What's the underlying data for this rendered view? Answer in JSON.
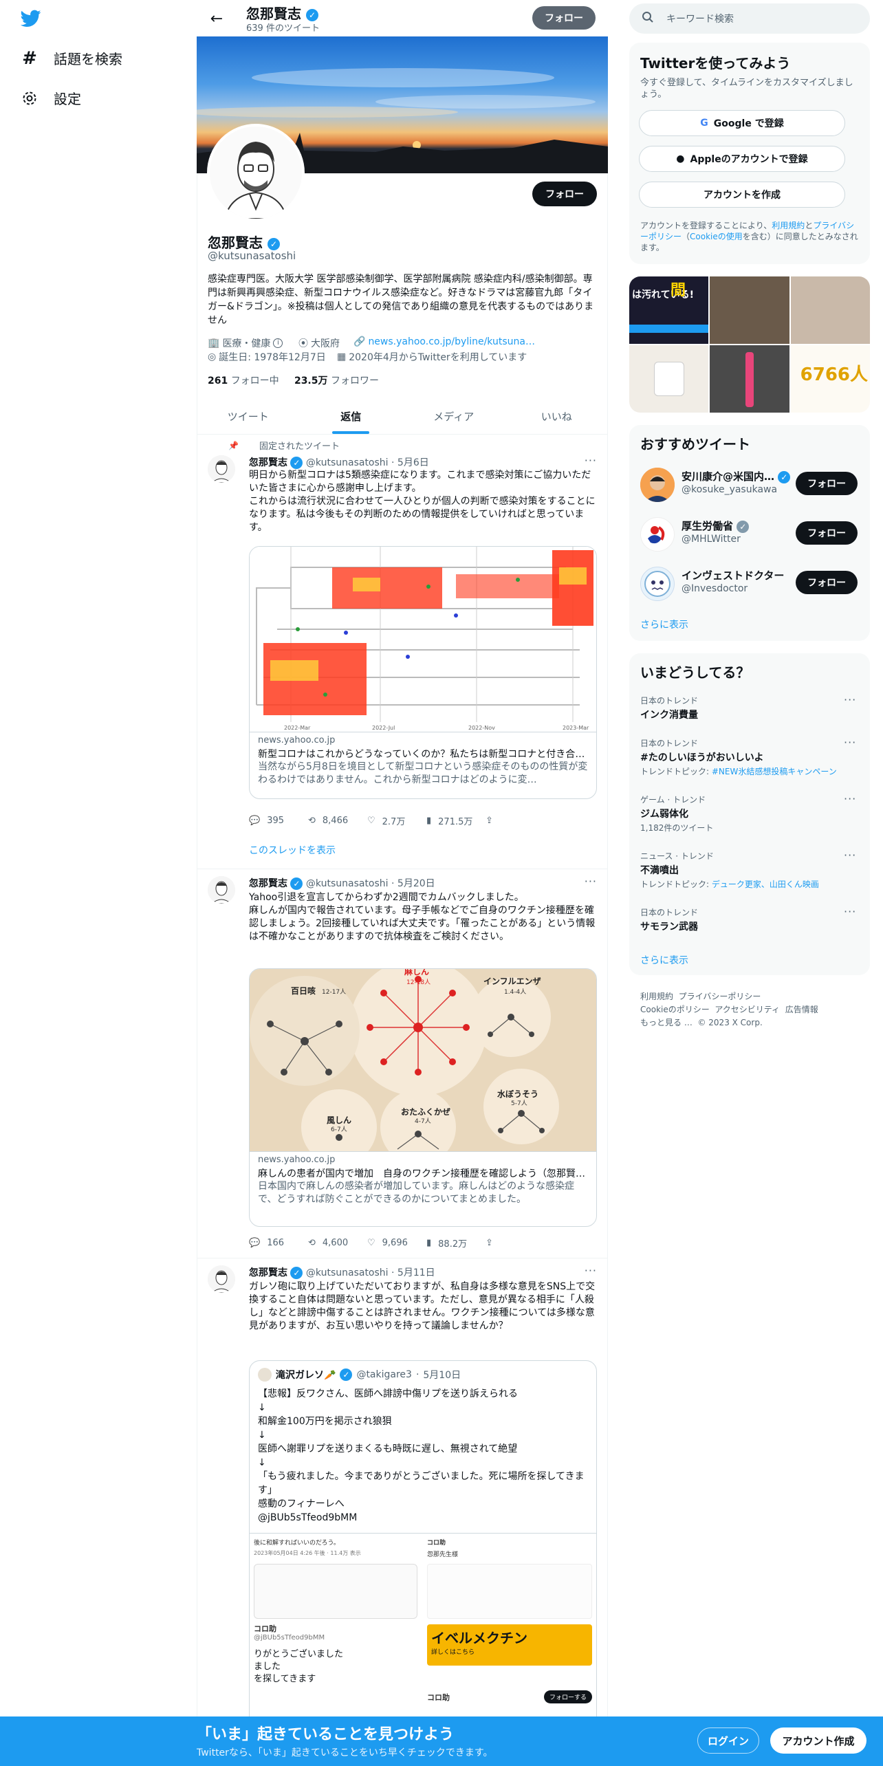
{
  "nav": {
    "explore_label": "話題を検索",
    "settings_label": "設定"
  },
  "header": {
    "name": "忽那賢志",
    "tweet_count": "639 件のツイート",
    "follow_label": "フォロー"
  },
  "profile": {
    "name": "忽那賢志",
    "handle": "@kutsunasatoshi",
    "follow_label": "フォロー",
    "bio": "感染症専門医。大阪大学 医学部感染制御学、医学部附属病院 感染症内科/感染制御部。専門は新興再興感染症、新型コロナウイルス感染症など。好きなドラマは宮藤官九郎「タイガー&ドラゴン」。※投稿は個人としての発信であり組織の意見を代表するものではありません",
    "category": "医療・健康",
    "location": "大阪府",
    "website": "news.yahoo.co.jp/byline/kutsuna…",
    "birthday": "誕生日: 1978年12月7日",
    "joined": "2020年4月からTwitterを利用しています",
    "following_count": "261",
    "following_label": "フォロー中",
    "followers_count": "23.5万",
    "followers_label": "フォロワー"
  },
  "tabs": [
    {
      "label": "ツイート"
    },
    {
      "label": "返信",
      "active": true
    },
    {
      "label": "メディア"
    },
    {
      "label": "いいね"
    }
  ],
  "tweets": [
    {
      "pinned_label": "固定されたツイート",
      "name": "忽那賢志",
      "handle": "@kutsunasatoshi",
      "date": "5月6日",
      "text": "明日から新型コロナは5類感染症になります。これまで感染対策にご協力いただいた皆さまに心から感謝申し上げます。\nこれからは流行状況に合わせて一人ひとりが個人の判断で感染対策をすることになります。私は今後もその判断のための情報提供をしていければと思っています。",
      "card": {
        "domain": "news.yahoo.co.jp",
        "title": "新型コロナはこれからどうなっていくのか？私たちは新型コロナと付き合っていく",
        "desc": "当然ながら5月8日を境目として新型コロナという感染症そのものの性質が変わるわけではありません。これから新型コロナはどのように変…",
        "axis": [
          "2022-Mar",
          "2022-Jul",
          "2022-Nov",
          "2023-Mar"
        ]
      },
      "replies": "395",
      "retweets": "8,466",
      "likes": "2.7万",
      "views": "271.5万",
      "thread_link": "このスレッドを表示"
    },
    {
      "name": "忽那賢志",
      "handle": "@kutsunasatoshi",
      "date": "5月20日",
      "text": "Yahoo引退を宣言してからわずか2週間でカムバックしました。\n麻しんが国内で報告されています。母子手帳などでご自身のワクチン接種歴を確認しましょう。2回接種していれば大丈夫です。「罹ったことがある」という情報は不確かなことがありますので抗体検査をご検討ください。",
      "card": {
        "domain": "news.yahoo.co.jp",
        "title": "麻しんの患者が国内で増加　自身のワクチン接種歴を確認しよう（忽那賢志）",
        "desc": "日本国内で麻しんの感染者が増加しています。麻しんはどのような感染症で、どうすれば防ぐことができるのかについてまとめました。",
        "labels": {
          "measles": "麻しん",
          "measles_n": "12-18人",
          "pertussis": "百日咳",
          "pertussis_n": "12-17人",
          "flu": "インフルエンザ",
          "flu_n": "1.4-4人",
          "rubella": "風しん",
          "rubella_n": "6-7人",
          "mumps": "おたふくかぜ",
          "mumps_n": "4-7人",
          "chickenpox": "水ぼうそう",
          "chickenpox_n": "5-7人"
        }
      },
      "replies": "166",
      "retweets": "4,600",
      "likes": "9,696",
      "views": "88.2万"
    },
    {
      "name": "忽那賢志",
      "handle": "@kutsunasatoshi",
      "date": "5月11日",
      "text": "ガレソ砲に取り上げていただいておりますが、私自身は多様な意見をSNS上で交換すること自体は問題ないと思っています。ただし、意見が異なる相手に「人殺し」などと誹謗中傷することは許されません。ワクチン接種については多様な意見がありますが、お互い思いやりを持って議論しませんか？",
      "quote": {
        "name": "滝沢ガレソ🥕",
        "handle": "@takigare3",
        "date": "5月10日",
        "text": "【悲報】反ワクさん、医師へ誹謗中傷リプを送り訴えられる\n↓\n和解金100万円を掲示され狼狽\n↓\n医師へ謝罪リプを送りまくるも時既に遅し、無視されて絶望\n↓\n「もう疲れました。今までありがとうございました。死に場所を探してきます」\n感動のフィナーレへ\n@jBUb5sTfeod9bMM",
        "img_left_top": "後に和解すればいいのだろう。",
        "img_left_meta": "2023年05月04日 4:26 午後 · 11.4万 表示",
        "img_left_user": "コロ助",
        "img_left_handle": "@jBUb5sTfeod9bMM",
        "img_left_text": "りがとうございました\nました\nを探してきます",
        "img_right_user": "コロ助",
        "img_right_text": "忽那先生様",
        "img_right_ad": "イベルメクチン",
        "img_right_ad_sub": "詳しくはこちら",
        "img_right_follow": "フォローする"
      }
    }
  ],
  "sidebar": {
    "search_placeholder": "キーワード検索",
    "signup": {
      "title": "Twitterを使ってみよう",
      "desc": "今すぐ登録して、タイムラインをカスタマイズしましょう。",
      "google": "Google で登録",
      "apple": "Appleのアカウントで登録",
      "create": "アカウントを作成",
      "terms_prefix": "アカウントを登録することにより、",
      "terms_link": "利用規約",
      "terms_mid": "と",
      "privacy_link": "プライバシーポリシー",
      "cookie_prefix": "（",
      "cookie_link": "Cookieの使用",
      "terms_suffix": "を含む）に同意したとみなされます。"
    },
    "media_text": {
      "t1": "は汚れている!",
      "t2": "間",
      "t3": "6766人"
    },
    "recommend": {
      "title": "おすすめツイート",
      "users": [
        {
          "name": "安川康介@米国内…",
          "handle": "@kosuke_yasukawa",
          "follow": "フォロー"
        },
        {
          "name": "厚生労働省",
          "handle": "@MHLWitter",
          "follow": "フォロー"
        },
        {
          "name": "インヴェストドクター",
          "handle": "@Invesdoctor",
          "follow": "フォロー"
        }
      ],
      "more": "さらに表示"
    },
    "trends": {
      "title": "いまどうしてる？",
      "items": [
        {
          "context": "日本のトレンド",
          "title": "インク消費量",
          "sub": ""
        },
        {
          "context": "日本のトレンド",
          "title": "#たのしいほうがおいしいよ",
          "sub_prefix": "トレンドトピック: ",
          "sub_link": "#NEW氷結感想投稿キャンペーン"
        },
        {
          "context": "ゲーム · トレンド",
          "title": "ジム弱体化",
          "sub": "1,182件のツイート"
        },
        {
          "context": "ニュース · トレンド",
          "title": "不満噴出",
          "sub_prefix": "トレンドトピック: ",
          "sub_link": "デューク更家、山田くん映画"
        },
        {
          "context": "日本のトレンド",
          "title": "サモラン武器",
          "sub": ""
        }
      ],
      "more": "さらに表示"
    },
    "footer": {
      "l1a": "利用規約",
      "l1b": "プライバシーポリシー",
      "l2a": "Cookieのポリシー",
      "l2b": "アクセシビリティ",
      "l2c": "広告情報",
      "l3a": "もっと見る …",
      "l3b": "© 2023 X Corp."
    }
  },
  "bottom": {
    "title": "「いま」起きていることを見つけよう",
    "sub": "Twitterなら、「いま」起きていることをいち早くチェックできます。",
    "login": "ログイン",
    "signup": "アカウント作成"
  },
  "colors": {
    "accent": "#1d9bf0",
    "text": "#0f1419",
    "muted": "#536471"
  }
}
